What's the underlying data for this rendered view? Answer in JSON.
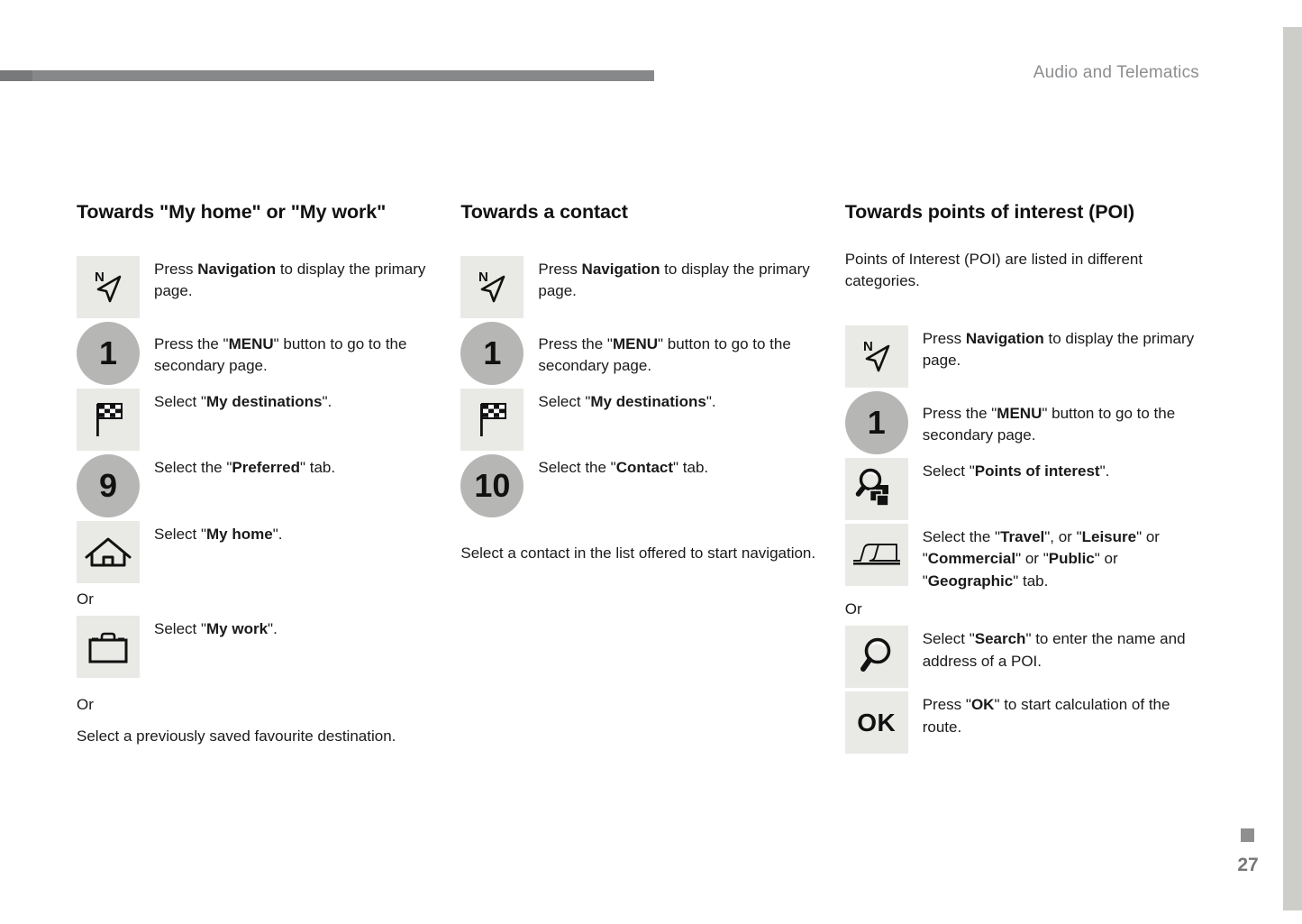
{
  "header": {
    "title": "Audio and Telematics"
  },
  "footer": {
    "page_number": "27",
    "marker_color": "#8e9090"
  },
  "colors": {
    "rule": "#86888a",
    "icon_box": "#e9eae5",
    "icon_circle": "#b6b7b5",
    "header_text": "#8c8e90",
    "right_band": "#cdcec9"
  },
  "columns": [
    {
      "id": "my-home-or-my-work",
      "title": "Towards \"My home\" or \"My work\"",
      "steps": [
        {
          "icon": "navigation-compass-icon",
          "icon_type": "box",
          "text_html": "Press <b>Navigation</b> to display the primary page."
        },
        {
          "icon": "step-number-1-icon",
          "icon_type": "circle",
          "label": "1",
          "text_html": "Press the \"<b>MENU</b>\" button to go to the secondary page."
        },
        {
          "icon": "checkered-flag-icon",
          "icon_type": "box",
          "text_html": "Select \"<b>My destinations</b>\"."
        },
        {
          "icon": "step-number-9-icon",
          "icon_type": "circle",
          "label": "9",
          "text_html": "Select the \"<b>Preferred</b>\" tab."
        },
        {
          "icon": "house-icon",
          "icon_type": "box",
          "text_html": "Select \"<b>My home</b>\"."
        }
      ],
      "or_1": "Or",
      "steps_2": [
        {
          "icon": "briefcase-icon",
          "icon_type": "box",
          "text_html": "Select \"<b>My work</b>\"."
        }
      ],
      "or_2": "Or",
      "closing": "Select a previously saved favourite destination."
    },
    {
      "id": "towards-a-contact",
      "title": "Towards a contact",
      "steps": [
        {
          "icon": "navigation-compass-icon",
          "icon_type": "box",
          "text_html": "Press <b>Navigation</b> to display the primary page."
        },
        {
          "icon": "step-number-1-icon",
          "icon_type": "circle",
          "label": "1",
          "text_html": "Press the \"<b>MENU</b>\" button to go to the secondary page."
        },
        {
          "icon": "checkered-flag-icon",
          "icon_type": "box",
          "text_html": "Select \"<b>My destinations</b>\"."
        },
        {
          "icon": "step-number-10-icon",
          "icon_type": "circle",
          "label": "10",
          "text_html": "Select the \"<b>Contact</b>\" tab."
        }
      ],
      "closing": "Select a contact in the list offered to start navigation."
    },
    {
      "id": "towards-points-of-interest",
      "title": "Towards points of interest (POI)",
      "intro": "Points of Interest (POI) are listed in different categories.",
      "steps": [
        {
          "icon": "navigation-compass-icon",
          "icon_type": "box",
          "text_html": "Press <b>Navigation</b> to display the primary page."
        },
        {
          "icon": "step-number-1-icon",
          "icon_type": "circle",
          "label": "1",
          "text_html": "Press the \"<b>MENU</b>\" button to go to the secondary page."
        },
        {
          "icon": "poi-search-icon",
          "icon_type": "box",
          "text_html": "Select \"<b>Points of interest</b>\"."
        },
        {
          "icon": "tab-shape-icon",
          "icon_type": "box",
          "text_html": "Select the \"<b>Travel</b>\", or \"<b>Leisure</b>\" or \"<b>Commercial</b>\" or \"<b>Public</b>\" or \"<b>Geographic</b>\" tab."
        }
      ],
      "or_1": "Or",
      "steps_2": [
        {
          "icon": "magnifier-icon",
          "icon_type": "box",
          "text_html": "Select \"<b>Search</b>\" to enter the name and address of a POI."
        },
        {
          "icon": "ok-button-icon",
          "icon_type": "box",
          "label": "OK",
          "text_html": "Press \"<b>OK</b>\" to start calculation of the route."
        }
      ]
    }
  ]
}
